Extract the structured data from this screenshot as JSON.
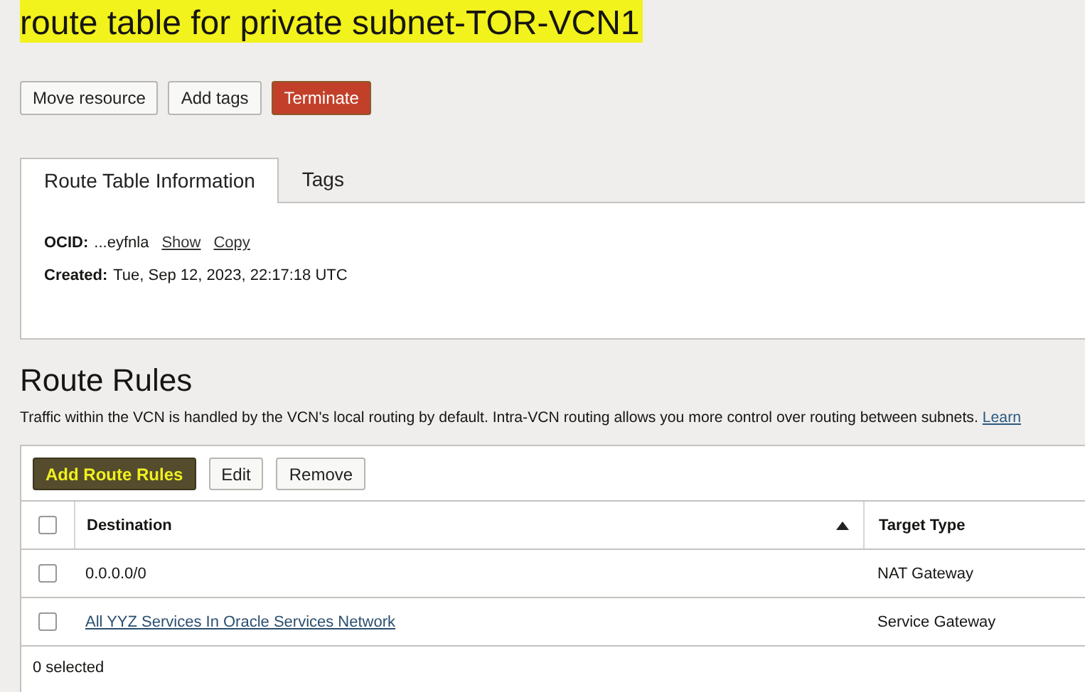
{
  "title": {
    "text": "route table for private subnet-TOR-VCN1",
    "highlighted": true
  },
  "actions": [
    {
      "label": "Move resource",
      "kind": "default"
    },
    {
      "label": "Add tags",
      "kind": "default"
    },
    {
      "label": "Terminate",
      "kind": "danger"
    }
  ],
  "tabs": [
    {
      "label": "Route Table Information",
      "selected": true
    },
    {
      "label": "Tags",
      "selected": false
    }
  ],
  "info": {
    "ocid_label": "OCID:",
    "ocid_value": "...eyfnla",
    "show_link": "Show",
    "copy_link": "Copy",
    "created_label": "Created:",
    "created_value": "Tue, Sep 12, 2023, 22:17:18 UTC"
  },
  "section": {
    "title": "Route Rules",
    "description": "Traffic within the VCN is handled by the VCN's local routing by default. Intra-VCN routing allows you more control over routing between subnets.",
    "link": "Learn"
  },
  "toolbar": [
    {
      "label": "Add Route Rules",
      "kind": "primary"
    },
    {
      "label": "Edit",
      "kind": "default"
    },
    {
      "label": "Remove",
      "kind": "default"
    }
  ],
  "table": {
    "select_all_checked": false,
    "columns": [
      {
        "label": "Destination",
        "sorted": true
      },
      {
        "label": "Target Type",
        "sorted": false
      }
    ],
    "rows": [
      {
        "checked": false,
        "destination": "0.0.0.0/0",
        "kind": "text",
        "target_type": "NAT Gateway"
      },
      {
        "checked": false,
        "destination": "All YYZ Services In Oracle Services Network",
        "kind": "link",
        "target_type": "Service Gateway"
      }
    ],
    "footer": "0 selected"
  }
}
